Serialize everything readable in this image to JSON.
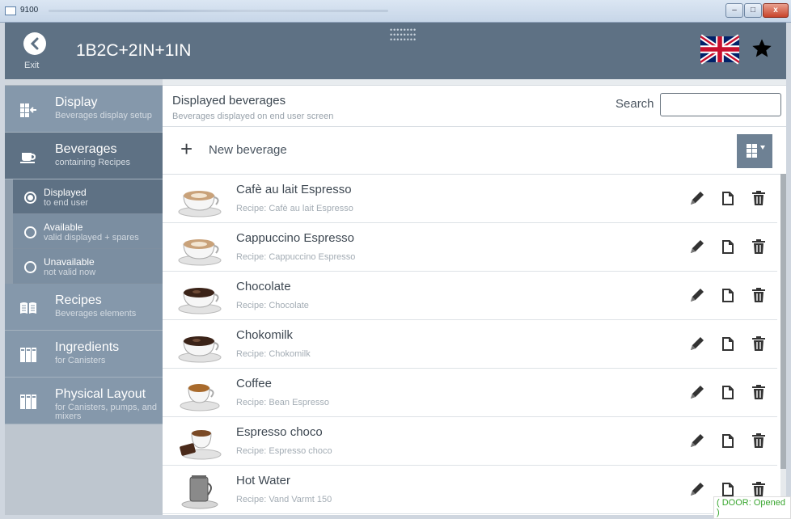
{
  "window": {
    "title": "9100",
    "minimize": "–",
    "maximize": "□",
    "close": "x"
  },
  "header": {
    "exit_label": "Exit",
    "title": "1B2C+2IN+1IN",
    "flag_icon": "uk-flag-icon",
    "favorite_icon": "star-icon"
  },
  "sidebar": {
    "items": [
      {
        "title": "Display",
        "subtitle": "Beverages display setup",
        "icon": "display-icon"
      },
      {
        "title": "Beverages",
        "subtitle": "containing Recipes",
        "icon": "cup-icon"
      },
      {
        "title": "Recipes",
        "subtitle": "Beverages elements",
        "icon": "book-icon"
      },
      {
        "title": "Ingredients",
        "subtitle": "for Canisters",
        "icon": "canister-icon"
      },
      {
        "title": "Physical Layout",
        "subtitle": "for Canisters, pumps, and mixers",
        "icon": "layout-icon"
      }
    ],
    "subitems": [
      {
        "title": "Displayed",
        "subtitle": "to end user"
      },
      {
        "title": "Available",
        "subtitle": "valid displayed + spares"
      },
      {
        "title": "Unavailable",
        "subtitle": "not valid now"
      }
    ]
  },
  "main": {
    "section_title": "Displayed beverages",
    "section_subtitle": "Beverages displayed on end user screen",
    "search_label": "Search",
    "search_value": "",
    "new_beverage_label": "New beverage",
    "beverages": [
      {
        "name": "Cafè au lait Espresso",
        "recipe": "Recipe: Cafè au lait Espresso",
        "cup": "latte"
      },
      {
        "name": "Cappuccino Espresso",
        "recipe": "Recipe: Cappuccino Espresso",
        "cup": "latte"
      },
      {
        "name": "Chocolate",
        "recipe": "Recipe: Chocolate",
        "cup": "dark"
      },
      {
        "name": "Chokomilk",
        "recipe": "Recipe: Chokomilk",
        "cup": "dark"
      },
      {
        "name": "Coffee",
        "recipe": "Recipe: Bean Espresso",
        "cup": "coffee"
      },
      {
        "name": "Espresso choco",
        "recipe": "Recipe: Espresso choco",
        "cup": "choco"
      },
      {
        "name": "Hot Water",
        "recipe": "Recipe: Vand Varmt 150",
        "cup": "water"
      }
    ]
  },
  "status": {
    "door": "( DOOR: Opened )"
  },
  "colors": {
    "header_bg": "#5e7184",
    "sidebar_item_bg": "#8598ab",
    "status_green": "#3aa630"
  }
}
